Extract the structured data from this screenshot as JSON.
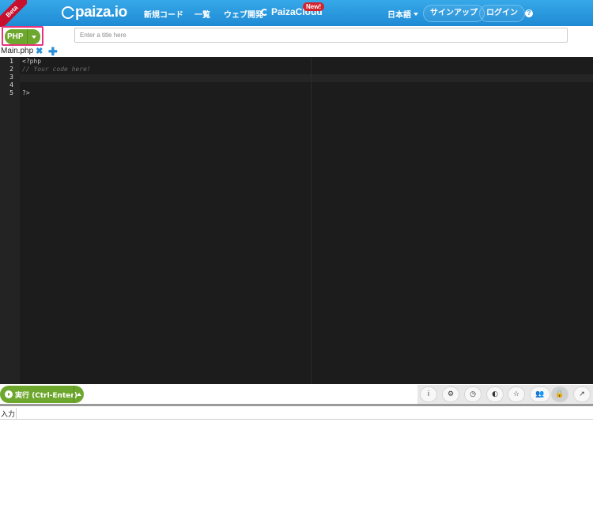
{
  "header": {
    "beta_label": "Beta",
    "logo_text": "paiza.io",
    "nav": {
      "new_code": "新規コード",
      "list": "一覧",
      "web_dev": "ウェブ開発",
      "paiza_cloud": "PaizaCloud",
      "new_badge": "New!"
    },
    "language": "日本語",
    "signup": "サインアップ",
    "login": "ログイン",
    "help": "?"
  },
  "toolbar": {
    "language_button": "PHP",
    "title_placeholder": "Enter a title here"
  },
  "files": {
    "active_tab": "Main.php",
    "close_glyph": "✖",
    "add_glyph": "✚"
  },
  "editor": {
    "lines": [
      {
        "no": "1",
        "text": "<?php"
      },
      {
        "no": "2",
        "text": "// Your code here!"
      },
      {
        "no": "3",
        "text": ""
      },
      {
        "no": "4",
        "text": ""
      },
      {
        "no": "5",
        "text": "?>"
      }
    ]
  },
  "bottom": {
    "run_button": "実行 (Ctrl-Enter)",
    "tools": {
      "info": "i",
      "settings": "⚙",
      "history": "◷",
      "github": "◐",
      "favorite": "☆",
      "collaboration": "👥",
      "lock": "🔒",
      "share": "↗"
    },
    "input_tab": "入力"
  },
  "colors": {
    "header_bg": "#2493db",
    "run_green": "#6ea72e",
    "highlight_border": "#e8337c",
    "editor_bg": "#1c1c1c",
    "accent_blue": "#2a8fd6"
  }
}
